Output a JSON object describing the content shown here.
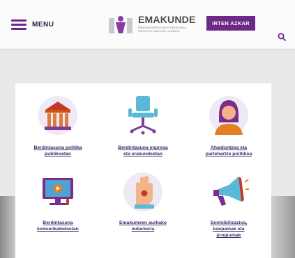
{
  "header": {
    "menu_label": "MENU",
    "logo_title": "EMAKUNDE",
    "logo_subtitle_1": "EMAKUMEAREN EUSKAL ERAKUNDEA",
    "logo_subtitle_2": "INSTITUTO VASCO DE LA MUJER",
    "cta_label": "IRTEN AZKAR",
    "brand_color": "#6c2a86"
  },
  "tiles": [
    {
      "title_1": "Berdintasuna politika",
      "title_2": "publikoetan",
      "icon": "institution-building-icon"
    },
    {
      "title_1": "Berdintasuna enpresa",
      "title_2": "eta erakundeetan",
      "icon": "office-chair-icon"
    },
    {
      "title_1": "Ahalduntzea eta",
      "title_2": "partehartze politikoa",
      "icon": "woman-avatar-icon"
    },
    {
      "title_1": "Berdintasuna",
      "title_2": "komunikabideetan",
      "icon": "television-icon"
    },
    {
      "title_1": "Emakumeen aurkako",
      "title_2": "indarkeria",
      "icon": "raised-hand-icon"
    },
    {
      "title_1": "Sentsibilizazioa,",
      "title_2": "kanpainak eta",
      "title_3": "programak",
      "icon": "megaphone-icon"
    }
  ]
}
